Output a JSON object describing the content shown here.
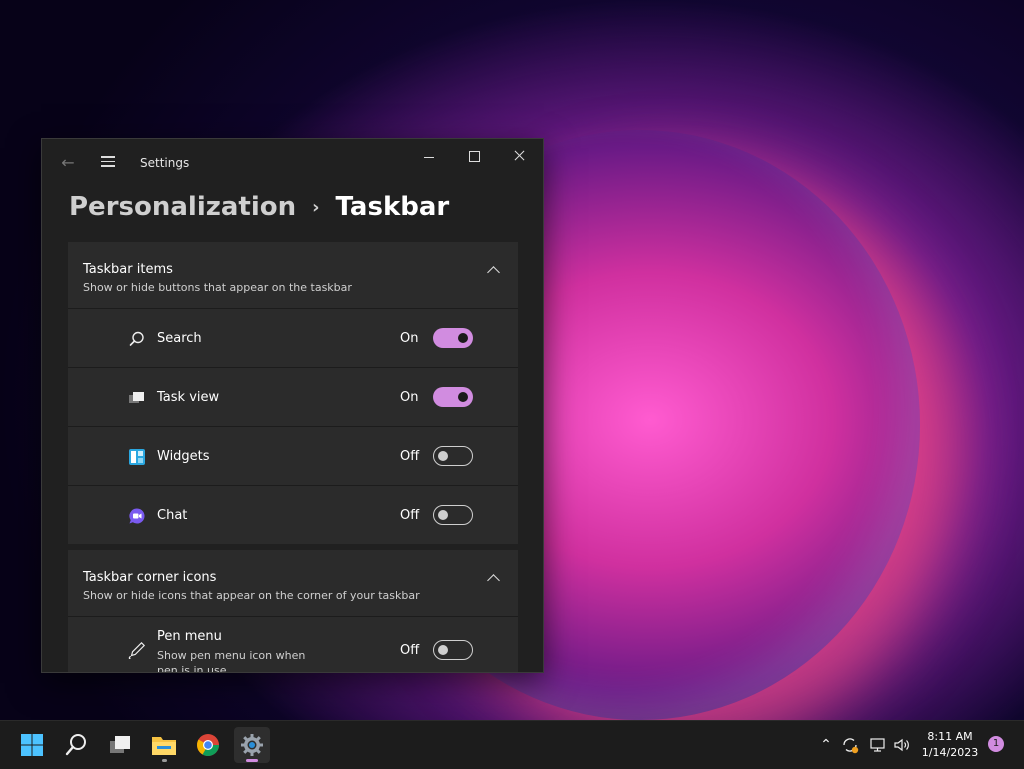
{
  "window": {
    "title": "Settings",
    "breadcrumb": {
      "parent": "Personalization",
      "separator": "›",
      "current": "Taskbar"
    }
  },
  "sections": {
    "taskbar_items": {
      "title": "Taskbar items",
      "description": "Show or hide buttons that appear on the taskbar",
      "items": [
        {
          "label": "Search",
          "state": "On",
          "icon": "search-icon"
        },
        {
          "label": "Task view",
          "state": "On",
          "icon": "task-view-icon"
        },
        {
          "label": "Widgets",
          "state": "Off",
          "icon": "widgets-icon"
        },
        {
          "label": "Chat",
          "state": "Off",
          "icon": "chat-icon"
        }
      ]
    },
    "corner_icons": {
      "title": "Taskbar corner icons",
      "description": "Show or hide icons that appear on the corner of your taskbar",
      "items": [
        {
          "label": "Pen menu",
          "description": "Show pen menu icon when pen is in use",
          "state": "Off",
          "icon": "pen-icon"
        }
      ]
    }
  },
  "taskbar": {
    "apps": [
      "start-icon",
      "search-icon",
      "task-view-icon",
      "file-explorer-icon",
      "chrome-icon",
      "settings-icon"
    ],
    "clock": {
      "time": "8:11 AM",
      "date": "1/14/2023"
    },
    "notification_count": "1"
  },
  "colors": {
    "accent": "#d18ce0",
    "window_bg": "#202020",
    "card_bg": "#2b2b2b"
  }
}
